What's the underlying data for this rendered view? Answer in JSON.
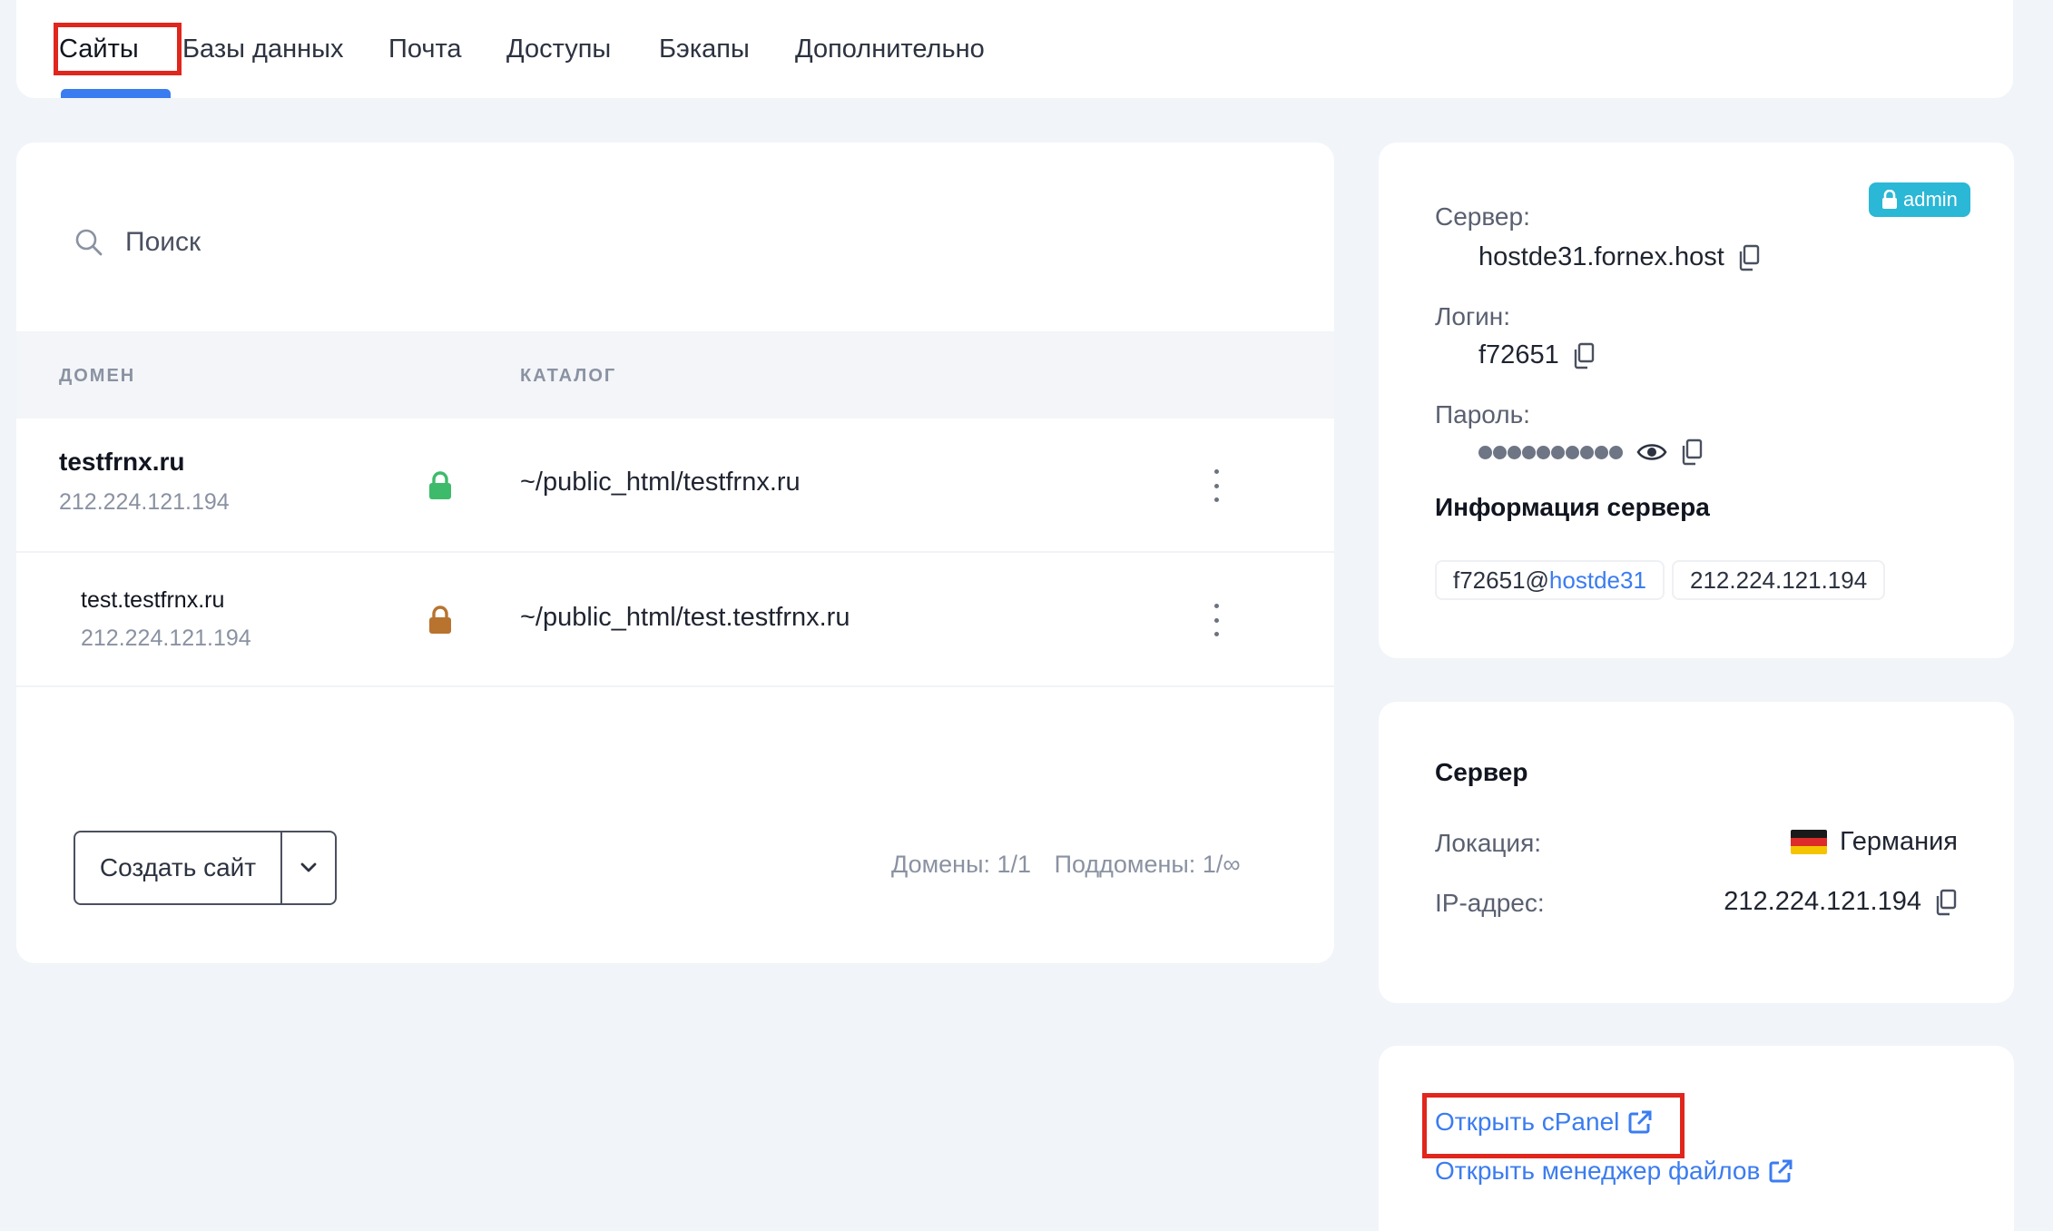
{
  "tabs": {
    "items": [
      {
        "label": "Сайты"
      },
      {
        "label": "Базы данных"
      },
      {
        "label": "Почта"
      },
      {
        "label": "Доступы"
      },
      {
        "label": "Бэкапы"
      },
      {
        "label": "Дополнительно"
      }
    ],
    "active": "Сайты"
  },
  "sites": {
    "search_placeholder": "Поиск",
    "columns": {
      "domain": "ДОМЕН",
      "catalog": "КАТАЛОГ"
    },
    "rows": [
      {
        "domain": "testfrnx.ru",
        "ip": "212.224.121.194",
        "ssl": "secure",
        "ssl_color": "#3dbb6a",
        "path": "~/public_html/testfrnx.ru"
      },
      {
        "domain": "test.testfrnx.ru",
        "ip": "212.224.121.194",
        "ssl": "insecure",
        "ssl_color": "#b8732f",
        "path": "~/public_html/test.testfrnx.ru"
      }
    ],
    "create_button": "Создать сайт",
    "domains_count": "Домены: 1/1",
    "subdomains_count": "Поддомены: 1/∞"
  },
  "credentials": {
    "badge": "admin",
    "server_label": "Сервер:",
    "server_value": "hostde31.fornex.host",
    "login_label": "Логин:",
    "login_value": "f72651",
    "password_label": "Пароль:",
    "server_info_title": "Информация сервера",
    "chip_user": "f72651@",
    "chip_host": "hostde31",
    "chip_ip": "212.224.121.194"
  },
  "server": {
    "title": "Сервер",
    "location_label": "Локация:",
    "location_value": "Германия",
    "ip_label": "IP-адрес:",
    "ip_value": "212.224.121.194"
  },
  "links": {
    "cpanel": "Открыть cPanel",
    "file_manager": "Открыть менеджер файлов"
  },
  "colors": {
    "accent": "#3b7cf0",
    "highlight": "#e0261d",
    "badge": "#2bb7d6"
  }
}
